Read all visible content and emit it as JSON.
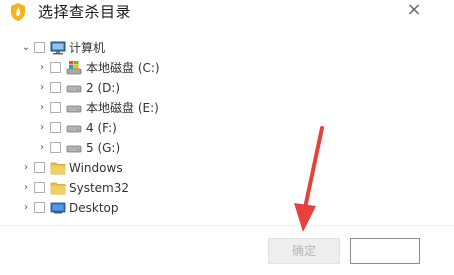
{
  "window": {
    "title": "选择查杀目录",
    "close_glyph": "×"
  },
  "tree": {
    "computer": {
      "label": "计算机",
      "expanded": true
    },
    "drives": [
      {
        "label": "本地磁盘 (C:)",
        "icon": "system-drive-icon"
      },
      {
        "label": "2 (D:)",
        "icon": "drive-icon"
      },
      {
        "label": "本地磁盘 (E:)",
        "icon": "drive-icon"
      },
      {
        "label": "4 (F:)",
        "icon": "drive-icon"
      },
      {
        "label": "5 (G:)",
        "icon": "drive-icon"
      }
    ],
    "folders": [
      {
        "label": "Windows",
        "icon": "folder-icon"
      },
      {
        "label": "System32",
        "icon": "folder-icon"
      },
      {
        "label": "Desktop",
        "icon": "desktop-icon"
      }
    ]
  },
  "footer": {
    "ok_label": "确定",
    "cancel_label": ""
  },
  "colors": {
    "arrow": "#e8403a",
    "folder": "#e8c04a",
    "drive": "#9a9a9a",
    "app_icon": "#f0a020"
  }
}
